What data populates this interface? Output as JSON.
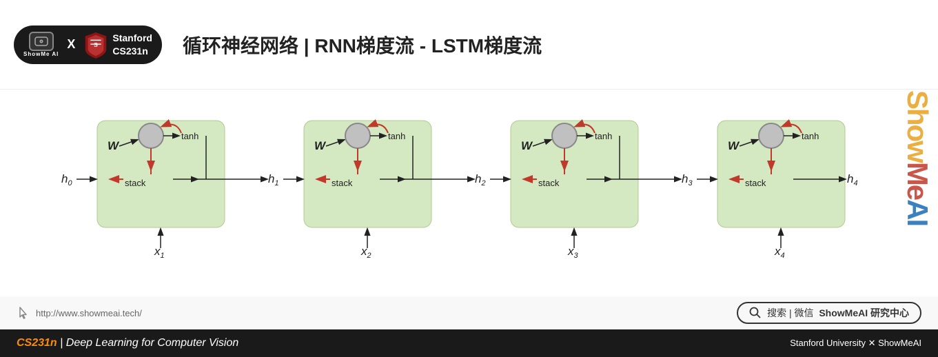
{
  "header": {
    "title": "循环神经网络 | RNN梯度流 - LSTM梯度流",
    "logo_text": "ShowMe AI",
    "stanford_line1": "Stanford",
    "stanford_line2": "CS231n",
    "x_symbol": "X"
  },
  "watermark": {
    "text": "ShowMeAI",
    "parts": [
      "Show",
      "Me",
      "AI"
    ]
  },
  "diagram": {
    "cells": [
      {
        "h_left": "h",
        "h_left_sub": "0",
        "h_right": "h",
        "h_right_sub": "1",
        "x_label": "x",
        "x_sub": "1"
      },
      {
        "h_left": "h",
        "h_left_sub": "1",
        "h_right": "h",
        "h_right_sub": "2",
        "x_label": "x",
        "x_sub": "2"
      },
      {
        "h_left": "h",
        "h_left_sub": "2",
        "h_right": "h",
        "h_right_sub": "3",
        "x_label": "x",
        "x_sub": "3"
      },
      {
        "h_left": "h",
        "h_left_sub": "3",
        "h_right": "h",
        "h_right_sub": "4",
        "x_label": "x",
        "x_sub": "4"
      }
    ],
    "w_label": "W",
    "tanh_label": "tanh",
    "stack_label": "stack"
  },
  "info_bar": {
    "url": "http://www.showmeai.tech/",
    "search_text": "搜索 | 微信  ShowMeAI 研究中心"
  },
  "footer": {
    "left_colored": "CS231n",
    "left_normal": "| Deep Learning for Computer Vision",
    "right": "Stanford University  ✕  ShowMeAI"
  }
}
